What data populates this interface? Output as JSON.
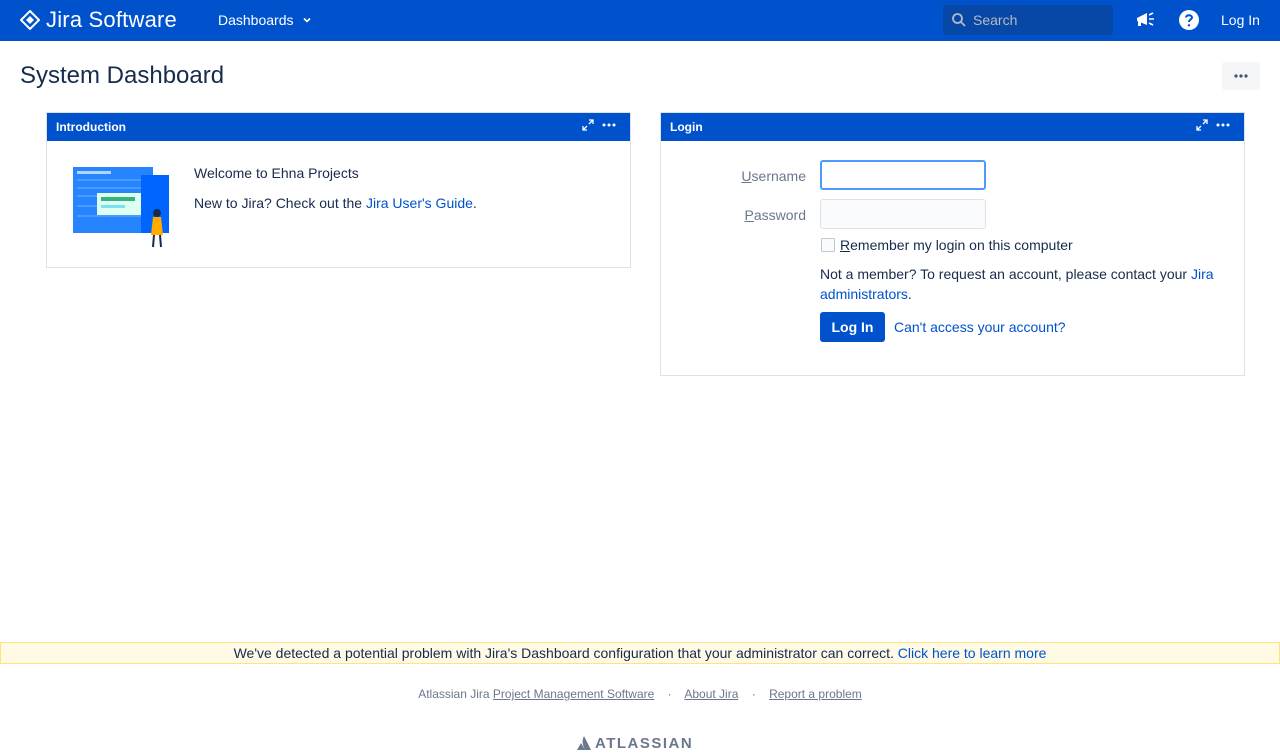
{
  "header": {
    "logo_text": "Jira Software",
    "nav_dashboards": "Dashboards",
    "search_placeholder": "Search",
    "login_label": "Log In",
    "icons": {
      "feedback": "megaphone-icon",
      "help": "help-icon",
      "search": "search-icon"
    }
  },
  "page": {
    "title": "System Dashboard"
  },
  "gadgets": {
    "intro": {
      "title": "Introduction",
      "welcome": "Welcome to Ehna Projects",
      "new_prefix": "New to Jira? Check out the ",
      "guide_link": "Jira User's Guide",
      "new_suffix": "."
    },
    "login": {
      "title": "Login",
      "username_first": "U",
      "username_rest": "sername",
      "password_first": "P",
      "password_rest": "assword",
      "remember_first": "R",
      "remember_rest": "emember my login on this computer",
      "member_text": "Not a member? To request an account, please contact your ",
      "admin_link": "Jira administrators",
      "member_suffix": ".",
      "login_button": "Log In",
      "cant_access": "Can't access your account?"
    }
  },
  "warning": {
    "text": "We've detected a potential problem with Jira's Dashboard configuration that your administrator can correct.",
    "link": "Click here to learn more"
  },
  "footer": {
    "prefix": "Atlassian Jira ",
    "pm_link": "Project Management Software",
    "sep": "·",
    "about": "About Jira",
    "report": "Report a problem",
    "brand": "ATLASSIAN"
  },
  "colors": {
    "brand": "#0052cc",
    "warning_bg": "#fffae6",
    "warning_border": "#ffe380"
  }
}
